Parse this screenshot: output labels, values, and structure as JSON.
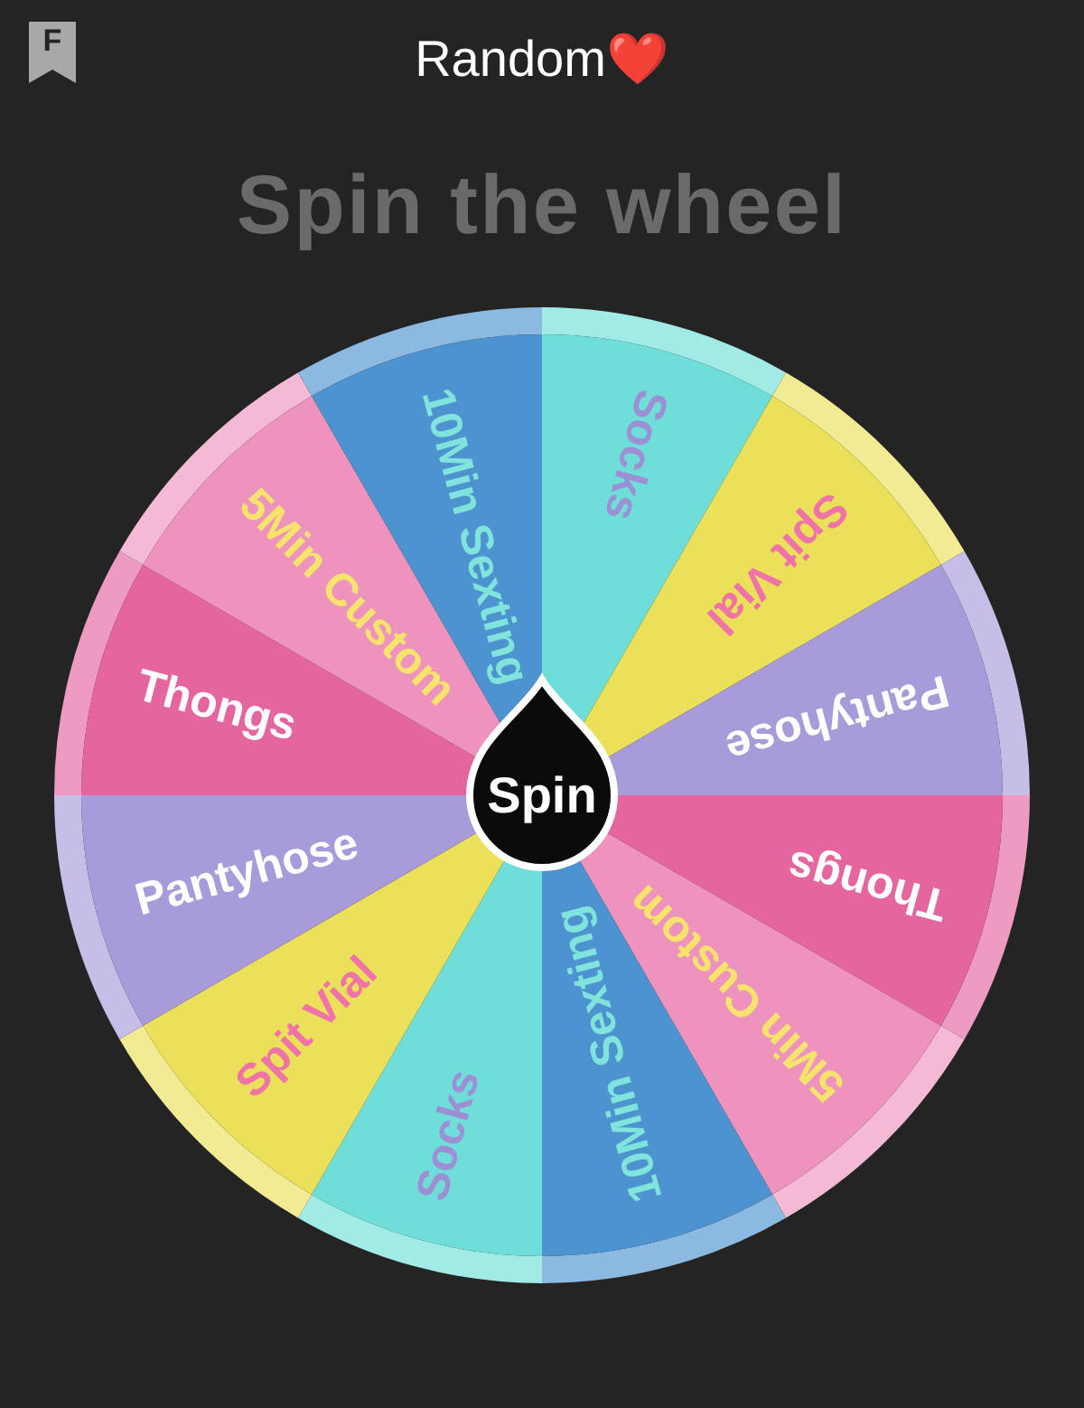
{
  "header": {
    "app_letter": "F",
    "title": "Random❤️"
  },
  "heading": "Spin the wheel",
  "wheel": {
    "segments": [
      {
        "label": "Socks",
        "color": "#6fded8"
      },
      {
        "label": "Spit Vial",
        "color": "#ebe05a"
      },
      {
        "label": "Pantyhose",
        "color": "#a99ada"
      },
      {
        "label": "Thongs",
        "color": "#e5659f"
      },
      {
        "label": "5Min Custom",
        "color": "#ee93bd"
      },
      {
        "label": "10Min Sexting",
        "color": "#4c93d0"
      },
      {
        "label": "Socks",
        "color": "#6fded8"
      },
      {
        "label": "Spit Vial",
        "color": "#ebe05a"
      },
      {
        "label": "Pantyhose",
        "color": "#a99ada"
      },
      {
        "label": "Thongs",
        "color": "#e5659f"
      },
      {
        "label": "5Min Custom",
        "color": "#ee93bd"
      },
      {
        "label": "10Min Sexting",
        "color": "#4c93d0"
      }
    ],
    "spin_button": "Spin"
  }
}
